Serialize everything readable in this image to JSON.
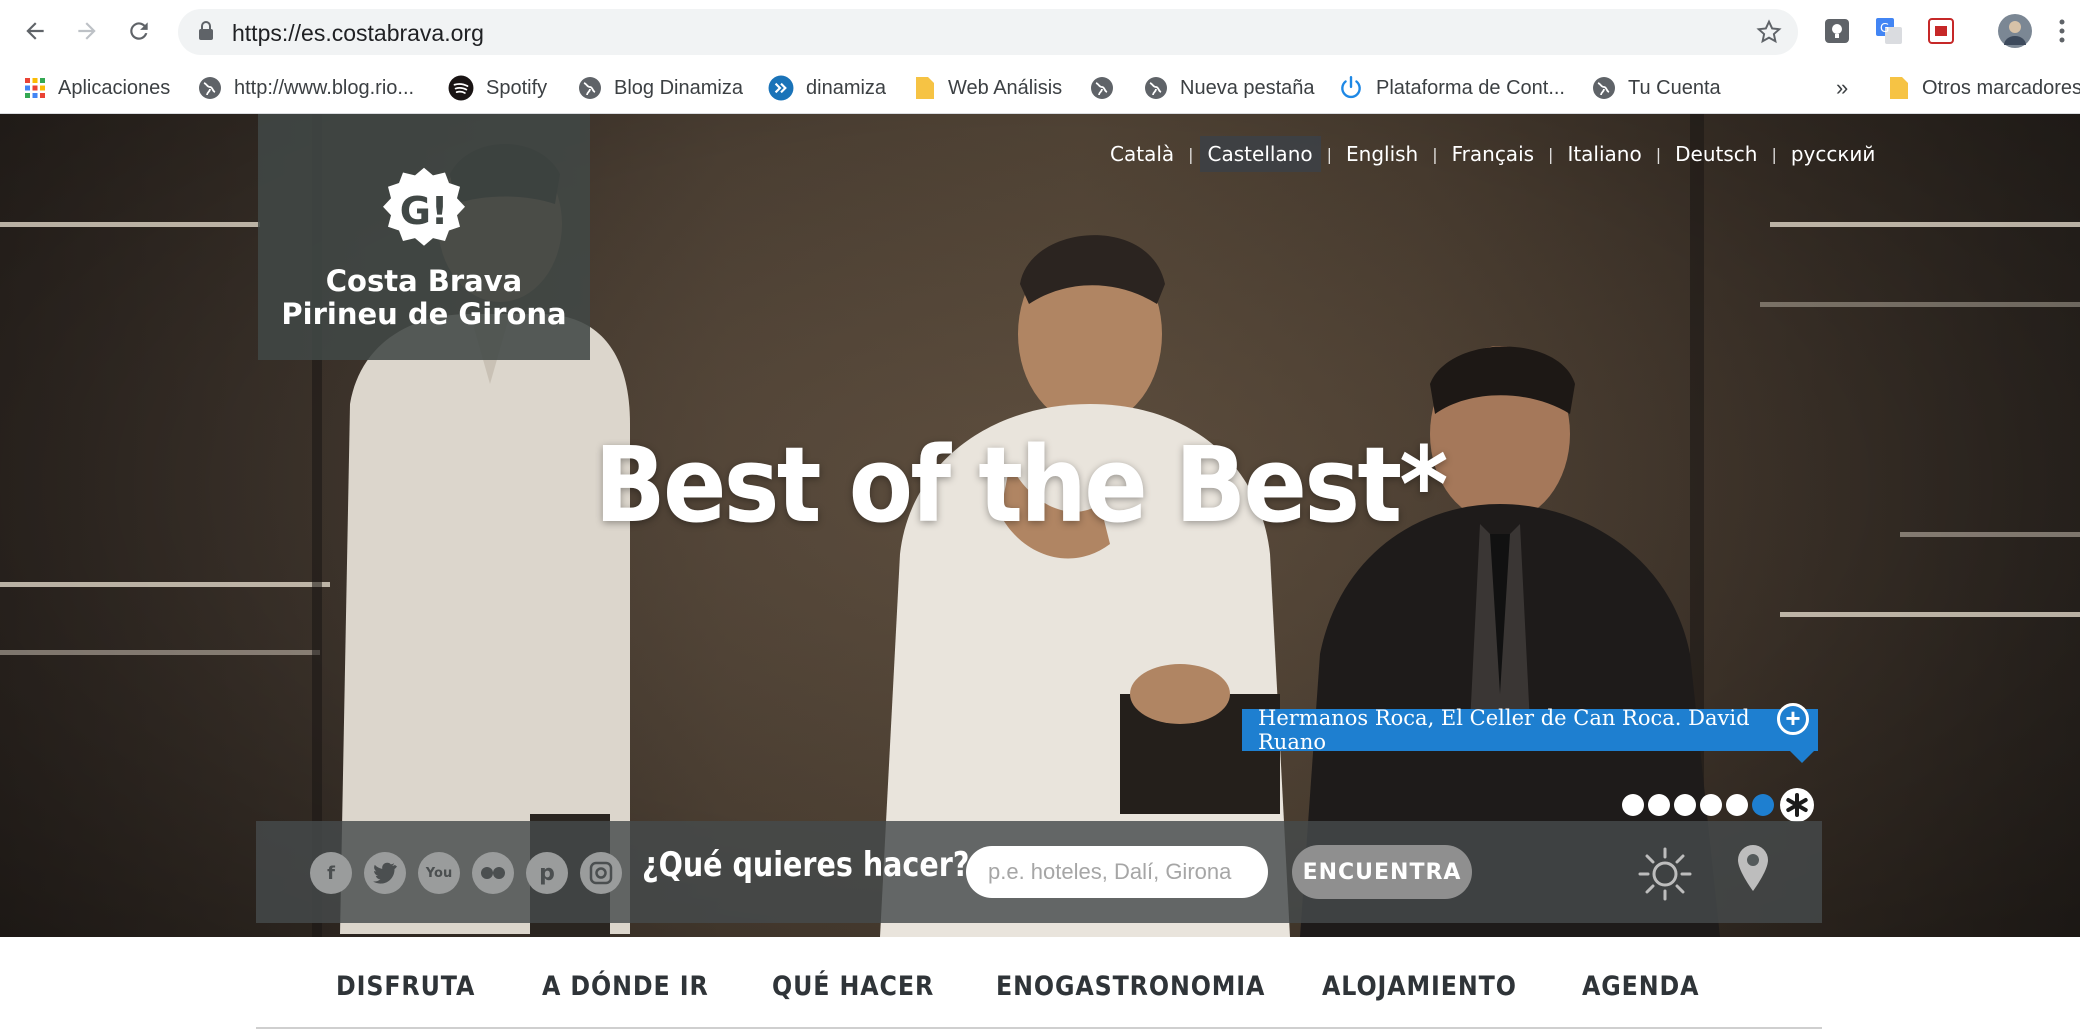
{
  "browser": {
    "url": "https://es.costabrava.org",
    "bookmarks": [
      {
        "label": "Aplicaciones",
        "icon": "apps-grid-icon"
      },
      {
        "label": "http://www.blog.rio...",
        "icon": "globe-icon"
      },
      {
        "label": "Spotify",
        "icon": "spotify-icon"
      },
      {
        "label": "Blog Dinamiza",
        "icon": "globe-icon"
      },
      {
        "label": "dinamiza",
        "icon": "dinamiza-icon"
      },
      {
        "label": "Web Análisis",
        "icon": "folder-icon"
      },
      {
        "label": "",
        "icon": "globe-icon"
      },
      {
        "label": "Nueva pestaña",
        "icon": "globe-icon"
      },
      {
        "label": "Plataforma de Cont...",
        "icon": "power-icon"
      },
      {
        "label": "Tu Cuenta",
        "icon": "globe-icon"
      }
    ],
    "overflow_label": "»",
    "other_bookmarks": "Otros marcadores"
  },
  "site": {
    "logo_line1": "Costa Brava",
    "logo_line2": "Pirineu de Girona",
    "logo_badge": "G!",
    "languages": [
      {
        "label": "Català",
        "active": false
      },
      {
        "label": "Castellano",
        "active": true
      },
      {
        "label": "English",
        "active": false
      },
      {
        "label": "Français",
        "active": false
      },
      {
        "label": "Italiano",
        "active": false
      },
      {
        "label": "Deutsch",
        "active": false
      },
      {
        "label": "русский",
        "active": false
      }
    ],
    "headline": "Best of the Best*",
    "caption": "Hermanos Roca, El Celler de Can Roca. David Ruano",
    "slides": {
      "count": 6,
      "active_index": 5
    },
    "search": {
      "label": "¿Qué quieres hacer?",
      "placeholder": "p.e. hoteles, Dalí, Girona",
      "button": "ENCUENTRA"
    },
    "social": [
      "facebook-icon",
      "twitter-icon",
      "youtube-icon",
      "flickr-icon",
      "pinterest-icon",
      "instagram-icon"
    ],
    "nav": [
      "DISFRUTA",
      "A DÓNDE IR",
      "QUÉ HACER",
      "ENOGASTRONOMIA",
      "ALOJAMIENTO",
      "AGENDA"
    ],
    "accent_color": "#1e7fd0"
  }
}
